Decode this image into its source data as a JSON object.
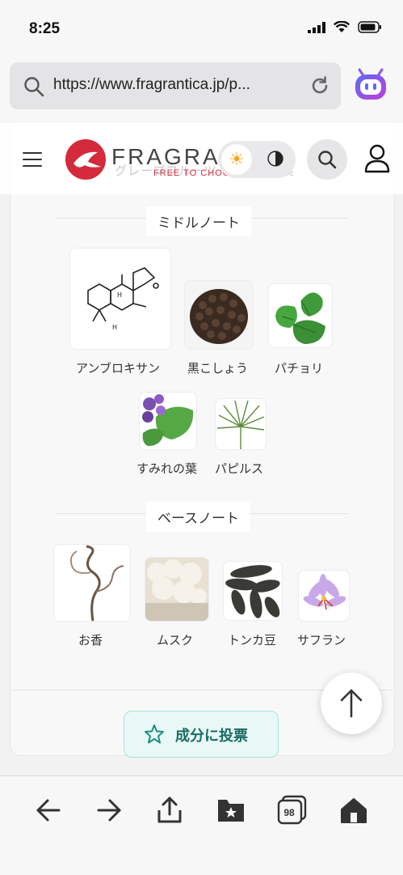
{
  "status": {
    "time": "8:25"
  },
  "browser": {
    "url": "https://www.fragrantica.jp/p..."
  },
  "site": {
    "brand": "FRAGRANT",
    "tagline": "FREE TO CHOOSE",
    "ghost_text": "グレープフルーツ　　　　　葉",
    "theme_sun": "☀",
    "theme_moon": "🌗"
  },
  "middle": {
    "title": "ミドルノート",
    "notes": [
      {
        "label": "アンブロキサン",
        "icon": "ambroxan-structure"
      },
      {
        "label": "黒こしょう",
        "icon": "black-pepper"
      },
      {
        "label": "パチョリ",
        "icon": "patchouli-leaf"
      },
      {
        "label": "すみれの葉",
        "icon": "violet-leaf"
      },
      {
        "label": "パピルス",
        "icon": "papyrus"
      }
    ]
  },
  "base": {
    "title": "ベースノート",
    "notes": [
      {
        "label": "お香",
        "icon": "incense-smoke"
      },
      {
        "label": "ムスク",
        "icon": "musk"
      },
      {
        "label": "トンカ豆",
        "icon": "tonka-beans"
      },
      {
        "label": "サフラン",
        "icon": "saffron-flower"
      }
    ]
  },
  "vote_button": {
    "label": "成分に投票"
  },
  "toolbar": {
    "tabs_count": "98"
  },
  "colors": {
    "brand_red": "#d42a3c",
    "vote_bg": "#e7f8f6",
    "vote_text": "#1b6b63"
  }
}
